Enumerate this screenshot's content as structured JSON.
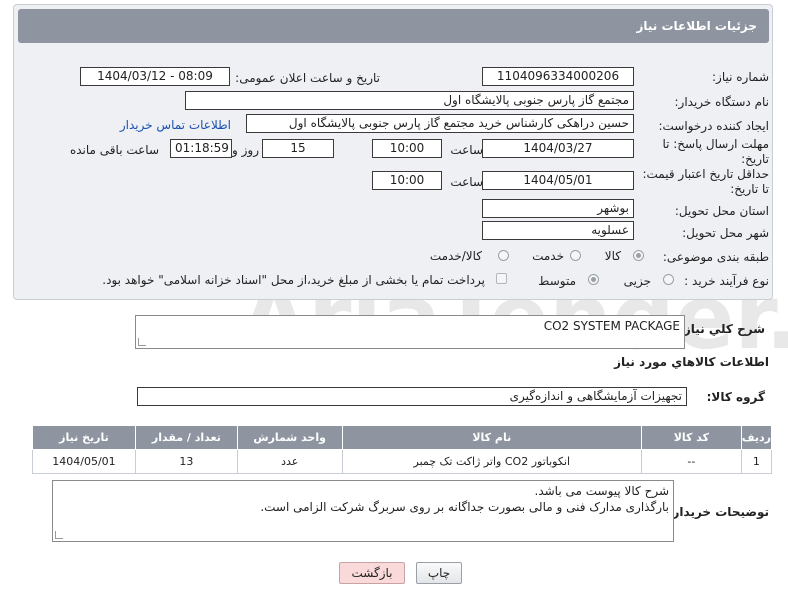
{
  "header": {
    "title": "جزئیات اطلاعات نیاز"
  },
  "fields": {
    "need_number_label": "شماره نیاز:",
    "need_number": "1104096334000206",
    "announce_label": "تاریخ و ساعت اعلان عمومی:",
    "announce_value": "1404/03/12 - 08:09",
    "buyer_org_label": "نام دستگاه خریدار:",
    "buyer_org": "مجتمع گاز پارس جنوبی  پالایشگاه اول",
    "requester_label": "ایجاد کننده درخواست:",
    "requester": "حسین دراهکی کارشناس خرید مجتمع گاز پارس جنوبی  پالایشگاه اول",
    "contact_link": "اطلاعات تماس خریدار",
    "deadline_label_1": "مهلت ارسال پاسخ: تا",
    "deadline_label_2": "تاریخ:",
    "deadline_date": "1404/03/27",
    "time_label": "ساعت",
    "deadline_time": "10:00",
    "days_value": "15",
    "days_label": "روز و",
    "remaining_time": "01:18:59",
    "remaining_label": "ساعت باقی مانده",
    "validity_label_1": "حداقل تاریخ اعتبار قیمت:",
    "validity_label_2": "تا تاریخ:",
    "validity_date": "1404/05/01",
    "validity_time": "10:00",
    "province_label": "استان محل تحویل:",
    "province": "بوشهر",
    "city_label": "شهر محل تحویل:",
    "city": "عسلویه",
    "category_label": "طبقه بندی موضوعی:",
    "category_options": [
      "کالا",
      "خدمت",
      "کالا/خدمت"
    ],
    "category_selected": "کالا",
    "process_label": "نوع فرآیند خرید :",
    "process_options": [
      "جزیی",
      "متوسط"
    ],
    "process_selected": "متوسط",
    "payment_note": "پرداخت تمام یا بخشی از مبلغ خرید،از محل \"اسناد خزانه اسلامی\" خواهد بود."
  },
  "summary": {
    "label": "شرح کلي نياز:",
    "value": "CO2 SYSTEM PACKAGE"
  },
  "goods_section": {
    "title": "اطلاعات کالاهاي مورد نياز",
    "group_label": "گروه کالا:",
    "group_value": "تجهیزات آزمایشگاهی و اندازه‌گیری",
    "columns": [
      "ردیف",
      "کد کالا",
      "نام کالا",
      "واحد شمارش",
      "تعداد / مقدار",
      "تاریخ نیاز"
    ],
    "rows": [
      [
        "1",
        "--",
        "انکوباتور CO2 واتر ژاکت تک چمبر",
        "عدد",
        "13",
        "1404/05/01"
      ]
    ]
  },
  "buyer_notes": {
    "label": "توضیحات خریدار:",
    "lines": [
      "شرح کالا پیوست می باشد.",
      "بارگذاری مدارک فنی و مالی بصورت جداگانه بر روی سربرگ شرکت الزامی است."
    ]
  },
  "buttons": {
    "print": "چاپ",
    "back": "بازگشت"
  },
  "watermark": "AriaTender.neT",
  "colors": {
    "header_bg": "#8e95a0",
    "panel_bg": "#eef0f4",
    "link": "#1a52b0",
    "back_button_bg": "#f9d9d9"
  }
}
